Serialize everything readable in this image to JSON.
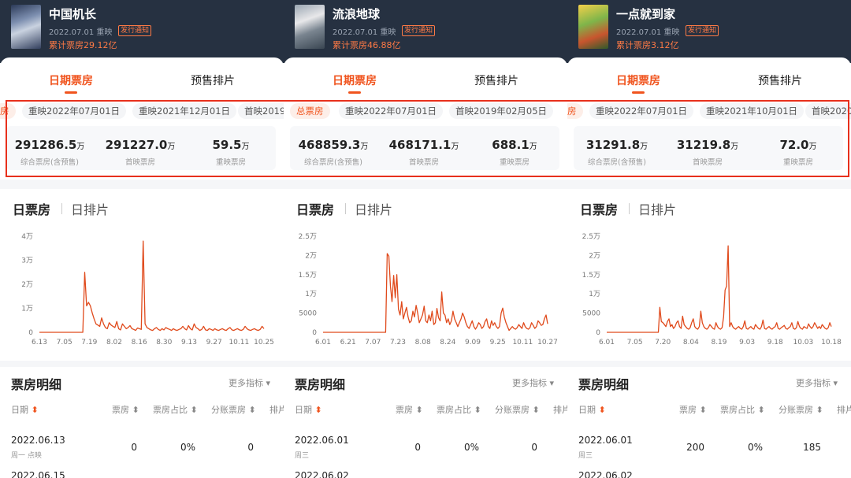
{
  "colors": {
    "accent": "#f0541e",
    "header_bg": "#263141",
    "highlight": "#e8301c",
    "line": "#e04a1c"
  },
  "ui": {
    "tab_date": "日期票房",
    "tab_presale": "预售排片",
    "chart_tab_daily": "日票房",
    "chart_tab_schedule": "日排片",
    "detail_title": "票房明细",
    "more_metrics": "更多指标 ▾",
    "col_date": "日期",
    "col_box": "票房",
    "col_share": "票房占比",
    "col_split": "分账票房",
    "col_rank": "排片",
    "sort_icon": "⬍"
  },
  "movies": [
    {
      "title": "流浪地球",
      "release_info": "2022.07.01 重映",
      "badge": "发行通知",
      "cumulative": "累计票房46.88亿",
      "chips": [
        "总票房",
        "重映2022年07月01日",
        "首映2019年02月05日"
      ],
      "stats": [
        {
          "value": "468859.3",
          "unit": "万",
          "label": "综合票房(含预售)"
        },
        {
          "value": "468171.1",
          "unit": "万",
          "label": "首映票房"
        },
        {
          "value": "688.1",
          "unit": "万",
          "label": "重映票房"
        }
      ],
      "row1": {
        "date": "2022.06.01",
        "sub": "周三",
        "box": "0",
        "share": "0%",
        "split": "0"
      },
      "row2_date": "2022.06.02"
    },
    {
      "title": "一点就到家",
      "release_info": "2022.07.01 重映",
      "badge": "发行通知",
      "cumulative": "累计票房3.12亿",
      "chips": [
        "房",
        "重映2022年07月01日",
        "重映2021年10月01日",
        "首映2020"
      ],
      "stats": [
        {
          "value": "31291.8",
          "unit": "万",
          "label": "综合票房(含预售)"
        },
        {
          "value": "31219.8",
          "unit": "万",
          "label": "首映票房"
        },
        {
          "value": "72.0",
          "unit": "万",
          "label": "重映票房"
        }
      ],
      "row1": {
        "date": "2022.06.01",
        "sub": "周三",
        "box": "200",
        "share": "0%",
        "split": "185"
      },
      "row2_date": "2022.06.02"
    },
    {
      "title": "中国机长",
      "release_info": "2022.07.01 重映",
      "badge": "发行通知",
      "cumulative": "累计票房29.12亿",
      "chips": [
        "房",
        "重映2022年07月01日",
        "重映2021年12月01日",
        "首映2019"
      ],
      "stats": [
        {
          "value": "291286.5",
          "unit": "万",
          "label": "综合票房(含预售)"
        },
        {
          "value": "291227.0",
          "unit": "万",
          "label": "首映票房"
        },
        {
          "value": "59.5",
          "unit": "万",
          "label": "重映票房"
        }
      ],
      "row1": {
        "date": "2022.06.13",
        "sub": "周一 点映",
        "box": "0",
        "share": "0%",
        "split": "0"
      },
      "row2_date": "2022.06.15"
    }
  ],
  "chart_data": [
    {
      "type": "line",
      "yticks": [
        "0",
        "5000",
        "1万",
        "1.5万",
        "2万",
        "2.5万"
      ],
      "ytick_values": [
        0,
        5000,
        10000,
        15000,
        20000,
        25000
      ],
      "ylim": [
        0,
        25000
      ],
      "xticks": [
        "6.01",
        "6.21",
        "7.07",
        "7.23",
        "8.08",
        "8.24",
        "9.09",
        "9.25",
        "10.11",
        "10.27"
      ],
      "values": [
        0,
        0,
        0,
        0,
        0,
        0,
        0,
        0,
        0,
        0,
        0,
        0,
        0,
        0,
        0,
        0,
        0,
        0,
        0,
        0,
        0,
        0,
        0,
        0,
        0,
        0,
        0,
        0,
        0,
        0,
        0,
        0,
        0,
        0,
        0,
        0,
        0,
        0,
        0,
        0,
        20500,
        19800,
        12000,
        8000,
        14800,
        9000,
        15000,
        6000,
        4500,
        8000,
        3500,
        5000,
        6500,
        4000,
        2500,
        3000,
        5500,
        4000,
        7000,
        5000,
        2500,
        3500,
        4500,
        6800,
        3000,
        2500,
        4500,
        3000,
        5500,
        2000,
        2500,
        6200,
        3800,
        3000,
        10500,
        5000,
        4500,
        2500,
        3500,
        2000,
        3000,
        5500,
        3500,
        2500,
        1500,
        2500,
        3500,
        5000,
        4000,
        2500,
        1500,
        1000,
        2000,
        3000,
        1500,
        800,
        1500,
        2500,
        2000,
        1000,
        1500,
        2800,
        3500,
        1500,
        1000,
        3000,
        1800,
        2500,
        1500,
        1000,
        1500,
        5000,
        6300,
        4000,
        2500,
        1500,
        500,
        1000,
        1500,
        1000,
        800,
        1200,
        2000,
        1500,
        1000,
        2500,
        1500,
        1000,
        800,
        1200,
        2500,
        1800,
        1000,
        1500,
        3000,
        2500,
        1800,
        2000,
        3500,
        4500,
        2200
      ]
    },
    {
      "type": "line",
      "yticks": [
        "0",
        "5000",
        "1万",
        "1.5万",
        "2万",
        "2.5万"
      ],
      "ytick_values": [
        0,
        5000,
        10000,
        15000,
        20000,
        25000
      ],
      "ylim": [
        0,
        25000
      ],
      "xticks": [
        "6.01",
        "7.05",
        "7.20",
        "8.04",
        "8.19",
        "9.03",
        "9.18",
        "10.03",
        "10.18"
      ],
      "values": [
        0,
        0,
        0,
        0,
        0,
        0,
        0,
        0,
        0,
        0,
        0,
        0,
        0,
        0,
        0,
        0,
        0,
        0,
        0,
        0,
        0,
        0,
        0,
        0,
        0,
        0,
        0,
        0,
        0,
        0,
        0,
        0,
        0,
        0,
        0,
        6500,
        2800,
        2500,
        2000,
        1500,
        2800,
        3500,
        1500,
        2000,
        1000,
        1500,
        2500,
        3000,
        1500,
        1000,
        4200,
        2000,
        1500,
        1000,
        800,
        1200,
        2500,
        3500,
        1500,
        1000,
        800,
        1500,
        5500,
        2500,
        1500,
        1000,
        800,
        1200,
        2000,
        1500,
        1000,
        800,
        2500,
        1500,
        1000,
        800,
        1200,
        4000,
        11000,
        12000,
        22500,
        1500,
        2500,
        1500,
        1000,
        800,
        1200,
        1500,
        1000,
        800,
        1500,
        3000,
        1000,
        800,
        1200,
        1500,
        1000,
        800,
        2000,
        1500,
        1000,
        800,
        1500,
        3200,
        1000,
        800,
        1200,
        1500,
        1000,
        800,
        1200,
        1500,
        2500,
        1000,
        800,
        1200,
        1500,
        1800,
        1000,
        800,
        1200,
        1500,
        2500,
        1000,
        800,
        1200,
        2800,
        1500,
        1000,
        800,
        1500,
        1200,
        1000,
        2200,
        1500,
        1000,
        1500,
        2500,
        1800,
        1000,
        1500,
        1000,
        2000,
        1500,
        1000,
        800,
        1200,
        2500,
        1500
      ]
    },
    {
      "type": "line",
      "yticks": [
        "0",
        "1万",
        "2万",
        "3万",
        "4万"
      ],
      "ytick_values": [
        0,
        10000,
        20000,
        30000,
        40000
      ],
      "ylim": [
        0,
        40000
      ],
      "xticks": [
        "6.13",
        "7.05",
        "7.19",
        "8.02",
        "8.16",
        "8.30",
        "9.13",
        "9.27",
        "10.11",
        "10.25"
      ],
      "values": [
        0,
        0,
        0,
        0,
        0,
        0,
        0,
        0,
        0,
        0,
        0,
        0,
        0,
        0,
        0,
        0,
        0,
        0,
        0,
        0,
        0,
        0,
        0,
        0,
        25000,
        11000,
        12500,
        11000,
        8000,
        5500,
        3500,
        3000,
        2500,
        6000,
        3500,
        2000,
        1500,
        4000,
        3000,
        2500,
        2000,
        4500,
        1500,
        1000,
        3500,
        2500,
        1500,
        2000,
        2800,
        1500,
        1200,
        800,
        1800,
        1500,
        1200,
        38000,
        3500,
        2000,
        1500,
        1000,
        800,
        1500,
        2000,
        1200,
        800,
        1500,
        1000,
        2000,
        1500,
        1200,
        800,
        1500,
        1000,
        800,
        1200,
        1500,
        2500,
        1500,
        1000,
        2800,
        1500,
        1000,
        3500,
        2000,
        1500,
        800,
        1200,
        2500,
        1000,
        800,
        1500,
        1200,
        800,
        1500,
        1000,
        800,
        1200,
        1500,
        1000,
        800,
        1500,
        2000,
        1000,
        800,
        1200,
        1500,
        1000,
        800,
        1200,
        2500,
        1500,
        1000,
        800,
        1200,
        1500,
        1000,
        800,
        1200,
        2500,
        1500
      ]
    }
  ]
}
